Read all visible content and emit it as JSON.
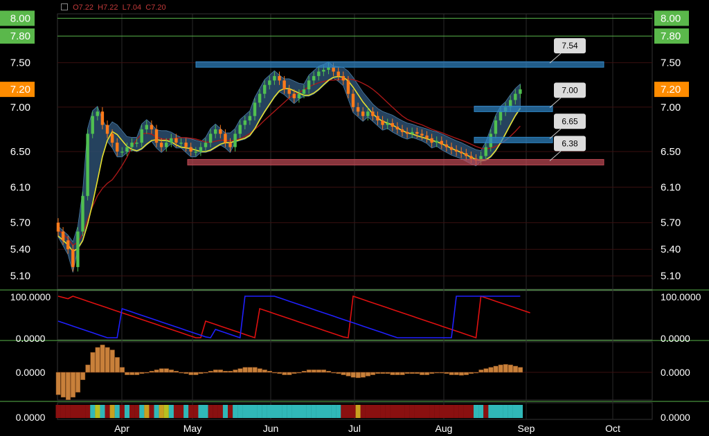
{
  "ohlc_readout": {
    "open": "O7.22",
    "high": "H7.22",
    "low": "L7.04",
    "close": "C7.20"
  },
  "chart_data": {
    "type": "candlestick",
    "title": "",
    "x_ticks": [
      "Apr",
      "May",
      "Jun",
      "Jul",
      "Aug",
      "Sep",
      "Oct"
    ],
    "y_ticks": [
      "5.10",
      "5.40",
      "5.70",
      "6.10",
      "6.50",
      "7.00",
      "7.50",
      "7.80",
      "8.00"
    ],
    "ylim": [
      4.95,
      8.05
    ],
    "highlighted_levels": [
      "8.00",
      "7.80"
    ],
    "last_price_label": "7.20",
    "levels": [
      {
        "label": "7.54",
        "price": 7.48,
        "color": "#2f86c6"
      },
      {
        "label": "7.00",
        "price": 6.98,
        "color": "#2f86c6"
      },
      {
        "label": "6.65",
        "price": 6.63,
        "color": "#2f86c6"
      },
      {
        "label": "6.38",
        "price": 6.38,
        "color": "#c04a55"
      }
    ],
    "close_series": [
      5.6,
      5.5,
      5.4,
      5.2,
      5.6,
      6.0,
      6.7,
      6.9,
      6.95,
      6.8,
      6.7,
      6.6,
      6.5,
      6.5,
      6.55,
      6.6,
      6.6,
      6.75,
      6.8,
      6.75,
      6.6,
      6.55,
      6.6,
      6.65,
      6.6,
      6.6,
      6.55,
      6.5,
      6.5,
      6.55,
      6.6,
      6.7,
      6.75,
      6.7,
      6.6,
      6.55,
      6.7,
      6.8,
      6.85,
      6.9,
      7.05,
      7.15,
      7.25,
      7.3,
      7.35,
      7.3,
      7.2,
      7.15,
      7.1,
      7.15,
      7.2,
      7.3,
      7.35,
      7.4,
      7.42,
      7.45,
      7.4,
      7.35,
      7.3,
      7.15,
      7.0,
      6.95,
      6.9,
      6.95,
      6.9,
      6.85,
      6.8,
      6.82,
      6.78,
      6.75,
      6.72,
      6.7,
      6.72,
      6.7,
      6.68,
      6.65,
      6.6,
      6.62,
      6.58,
      6.55,
      6.52,
      6.5,
      6.48,
      6.45,
      6.42,
      6.4,
      6.45,
      6.55,
      6.7,
      6.85,
      6.95,
      7.0,
      7.08,
      7.15,
      7.2
    ],
    "stochastic": {
      "axis_labels": [
        "100.0000",
        "0.0000"
      ],
      "red_series": [
        100,
        97,
        94,
        100,
        96,
        92,
        88,
        84,
        80,
        76,
        72,
        68,
        64,
        60,
        56,
        52,
        48,
        44,
        40,
        36,
        32,
        28,
        24,
        20,
        16,
        12,
        8,
        4,
        0,
        0,
        40,
        36,
        32,
        28,
        24,
        20,
        16,
        12,
        8,
        4,
        0,
        70,
        66,
        62,
        58,
        54,
        50,
        46,
        42,
        38,
        34,
        30,
        26,
        22,
        18,
        14,
        10,
        6,
        2,
        0,
        100,
        96,
        92,
        88,
        84,
        80,
        76,
        72,
        68,
        64,
        60,
        56,
        52,
        48,
        44,
        40,
        36,
        32,
        28,
        24,
        20,
        16,
        12,
        8,
        4,
        0,
        100,
        96,
        92,
        88,
        84,
        80,
        76,
        72,
        68,
        64,
        60
      ],
      "blue_series": [
        40,
        36,
        32,
        28,
        24,
        20,
        16,
        12,
        8,
        4,
        0,
        0,
        0,
        70,
        66,
        62,
        58,
        54,
        50,
        46,
        42,
        38,
        34,
        30,
        26,
        22,
        18,
        14,
        10,
        6,
        2,
        0,
        20,
        16,
        12,
        8,
        4,
        0,
        100,
        100,
        100,
        100,
        100,
        100,
        100,
        96,
        92,
        88,
        84,
        80,
        76,
        72,
        68,
        64,
        60,
        56,
        52,
        48,
        44,
        40,
        36,
        32,
        28,
        24,
        20,
        16,
        12,
        8,
        4,
        0,
        0,
        0,
        0,
        0,
        0,
        0,
        0,
        0,
        0,
        0,
        0,
        100,
        100,
        100,
        100,
        100,
        100,
        100,
        100,
        100,
        100,
        100,
        100,
        100,
        100
      ]
    },
    "histogram": {
      "axis_label": "0.0000",
      "values": [
        -0.9,
        -1.0,
        -1.1,
        -1.0,
        -0.8,
        -0.3,
        0.3,
        0.8,
        1.0,
        1.1,
        1.0,
        0.9,
        0.6,
        0.2,
        -0.1,
        -0.1,
        -0.1,
        -0.05,
        0,
        0.05,
        0.1,
        0.15,
        0.15,
        0.1,
        0.05,
        0,
        -0.05,
        -0.1,
        -0.1,
        -0.05,
        0,
        0.05,
        0.1,
        0.1,
        0.05,
        0.05,
        0.1,
        0.15,
        0.2,
        0.2,
        0.2,
        0.15,
        0.1,
        0.05,
        0,
        -0.05,
        -0.1,
        -0.1,
        -0.05,
        0,
        0.05,
        0.1,
        0.1,
        0.1,
        0.1,
        0.05,
        0,
        -0.05,
        -0.1,
        -0.15,
        -0.2,
        -0.22,
        -0.2,
        -0.15,
        -0.1,
        -0.05,
        -0.05,
        -0.05,
        -0.1,
        -0.1,
        -0.1,
        -0.05,
        -0.05,
        -0.05,
        -0.1,
        -0.1,
        -0.05,
        0,
        0,
        -0.05,
        -0.1,
        -0.1,
        -0.12,
        -0.1,
        -0.05,
        0,
        0.1,
        0.15,
        0.2,
        0.25,
        0.3,
        0.32,
        0.3,
        0.25,
        0.2
      ]
    },
    "signal_bar": {
      "axis_label": "0.0000",
      "segments": [
        "#8a1010",
        "#8a1010",
        "#8a1010",
        "#8a1010",
        "#8a1010",
        "#8a1010",
        "#8a1010",
        "#30b8b8",
        "#b8c020",
        "#30b8b8",
        "#8a1010",
        "#c8a020",
        "#30b8b8",
        "#8a1010",
        "#30b8b8",
        "#8a1010",
        "#8a1010",
        "#30b8b8",
        "#c8a020",
        "#8a1010",
        "#30b8b8",
        "#c8a020",
        "#b8c020",
        "#30b8b8",
        "#8a1010",
        "#8a1010",
        "#30b8b8",
        "#8a1010",
        "#8a1010",
        "#30b8b8",
        "#30b8b8",
        "#8a1010",
        "#8a1010",
        "#8a1010",
        "#30b8b8",
        "#8a1010",
        "#30b8b8",
        "#30b8b8",
        "#30b8b8",
        "#30b8b8",
        "#30b8b8",
        "#30b8b8",
        "#30b8b8",
        "#30b8b8",
        "#30b8b8",
        "#30b8b8",
        "#30b8b8",
        "#30b8b8",
        "#30b8b8",
        "#30b8b8",
        "#30b8b8",
        "#30b8b8",
        "#30b8b8",
        "#30b8b8",
        "#30b8b8",
        "#30b8b8",
        "#30b8b8",
        "#30b8b8",
        "#8a1010",
        "#8a1010",
        "#8a1010",
        "#c8a020",
        "#8a1010",
        "#8a1010",
        "#8a1010",
        "#8a1010",
        "#8a1010",
        "#8a1010",
        "#8a1010",
        "#8a1010",
        "#8a1010",
        "#8a1010",
        "#8a1010",
        "#8a1010",
        "#8a1010",
        "#8a1010",
        "#8a1010",
        "#8a1010",
        "#8a1010",
        "#8a1010",
        "#8a1010",
        "#8a1010",
        "#8a1010",
        "#8a1010",
        "#8a1010",
        "#30b8b8",
        "#30b8b8",
        "#8a1010",
        "#30b8b8",
        "#30b8b8",
        "#30b8b8",
        "#30b8b8",
        "#30b8b8",
        "#30b8b8",
        "#30b8b8"
      ]
    }
  },
  "colors": {
    "up": "#50c050",
    "down": "#ff7a1a",
    "grid": "#2a2a2a",
    "axis_green": "#5ab84b",
    "band_fill": "#2b4d6e",
    "yellow": "#e8e02c",
    "red_line": "#a81818",
    "blue_line": "#2020ff"
  }
}
